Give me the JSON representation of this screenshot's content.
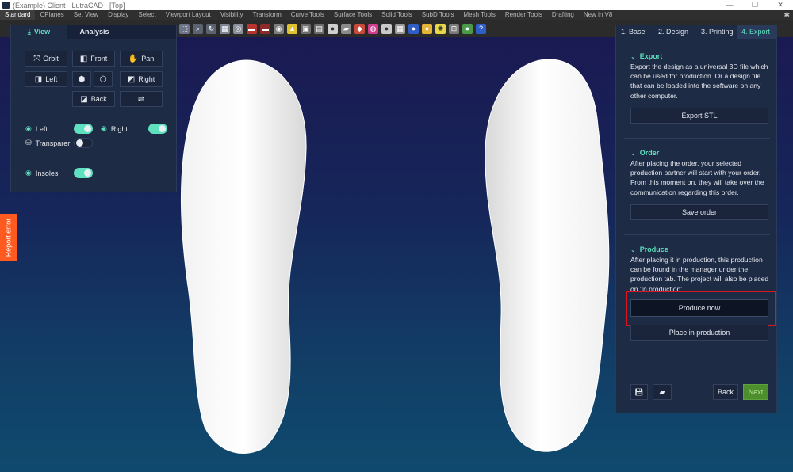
{
  "window": {
    "title": "(Example) Client - LutraCAD - [Top]"
  },
  "rhino_tabs": [
    "Standard",
    "CPlanes",
    "Set View",
    "Display",
    "Select",
    "Viewport Layout",
    "Visibility",
    "Transform",
    "Curve Tools",
    "Surface Tools",
    "Solid Tools",
    "SubD Tools",
    "Mesh Tools",
    "Render Tools",
    "Drafting",
    "New in V8"
  ],
  "view_panel": {
    "tabs": [
      "View",
      "Analysis"
    ],
    "buttons": {
      "orbit": "Orbit",
      "front": "Front",
      "pan": "Pan",
      "left": "Left",
      "right": "Right",
      "back": "Back"
    },
    "toggles": {
      "left": "Left",
      "right": "Right",
      "transparent": "Transparer",
      "insoles": "Insoles"
    }
  },
  "report_error": "Report error",
  "right_panel": {
    "tabs": [
      "1. Base",
      "2. Design",
      "3. Printing",
      "4. Export"
    ],
    "export": {
      "title": "Export",
      "text": "Export the design as a universal 3D file which can be used for production. Or a design file that can be loaded into the software on any other computer.",
      "button": "Export STL"
    },
    "order": {
      "title": "Order",
      "text": "After placing the order, your selected production partner will start with your order. From this moment on, they will take over the communication regarding this order.",
      "button": "Save order"
    },
    "produce": {
      "title": "Produce",
      "text": "After placing it in production, this production can be found in the manager under the production tab. The project will also be placed on 'In production'.",
      "button": "Produce now",
      "button2": "Place in production"
    },
    "footer": {
      "back": "Back",
      "next": "Next"
    }
  },
  "colors": {
    "accent": "#5fe0bf",
    "panel": "#1e2b45",
    "highlight": "#e0141e",
    "next": "#4c8f2c",
    "report": "#ff5a1f"
  }
}
